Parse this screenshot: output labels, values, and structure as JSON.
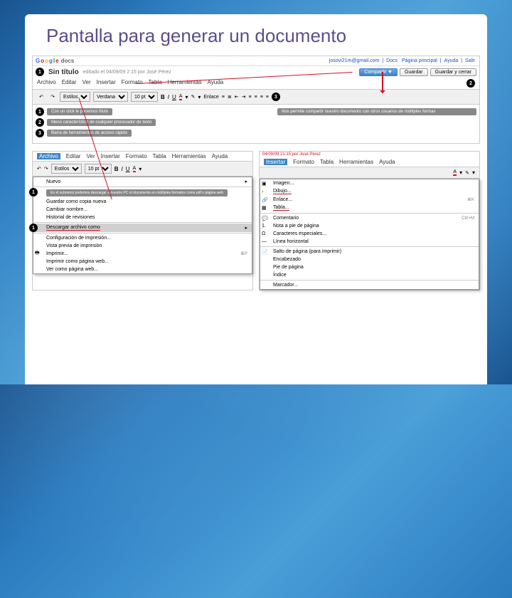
{
  "title": "Pantalla para generar un documento",
  "logo": {
    "brand": "Google",
    "product": "docs"
  },
  "header_links": {
    "email": "josovi21m@gmail.com",
    "docs": "Docs",
    "home": "Página principal",
    "help": "Ayuda",
    "exit": "Salir"
  },
  "doc": {
    "title": "Sin título",
    "saved": "editado el 04/09/09 2:15 por José Pérez"
  },
  "buttons": {
    "share": "Compartir",
    "save": "Guardar",
    "save_close": "Guardar y cerrar"
  },
  "menu": {
    "archivo": "Archivo",
    "editar": "Editar",
    "ver": "Ver",
    "insertar": "Insertar",
    "formato": "Formato",
    "tabla": "Tabla",
    "herramientas": "Herramientas",
    "ayuda": "Ayuda"
  },
  "toolbar": {
    "styles": "Estilos",
    "font": "Verdana",
    "size": "10 pt",
    "bold": "B",
    "italic": "I",
    "underline": "U",
    "link": "Enlace"
  },
  "callouts": {
    "c1": "Con un click le ponemos título",
    "c2": "Menú característico de cualquier procesador de texto",
    "c3": "Barra de herramientas de acceso rápido",
    "c4": "Nos permite compartir nuestro documento con otros usuarios de múltiples formas"
  },
  "archivo_menu": {
    "saved_header": "04/09/09 21:15 por José Pérez",
    "nuevo": "Nuevo",
    "desc": "En el submenú podemos descargar a nuestro PC el documento en múltiples formatos como pdf o página web",
    "guardar_copia": "Guardar como copia nueva",
    "cambiar": "Cambiar nombre...",
    "historial": "Historial de revisiones",
    "descargar": "Descargar archivo como",
    "config": "Configuración de impresión...",
    "vista": "Vista previa de impresión",
    "imprimir": "Imprimir...",
    "imprimir_kb": "⌘P",
    "imprimir_web": "Imprimir como página web...",
    "ver_web": "Ver como página web..."
  },
  "insertar_menu": {
    "imagen": "Imagen...",
    "dibujo": "Dibujo...",
    "enlace": "Enlace...",
    "enlace_kb": "⌘K",
    "tabla": "Tabla...",
    "comentario": "Comentario",
    "comentario_kb": "Ctrl+M",
    "nota": "Nota a pie de página",
    "caracteres": "Caracteres especiales...",
    "linea": "Línea horizontal",
    "salto": "Salto de página (para imprimir)",
    "encabezado": "Encabezado",
    "pie": "Pie de página",
    "indice": "Índice",
    "marcador": "Marcador..."
  }
}
